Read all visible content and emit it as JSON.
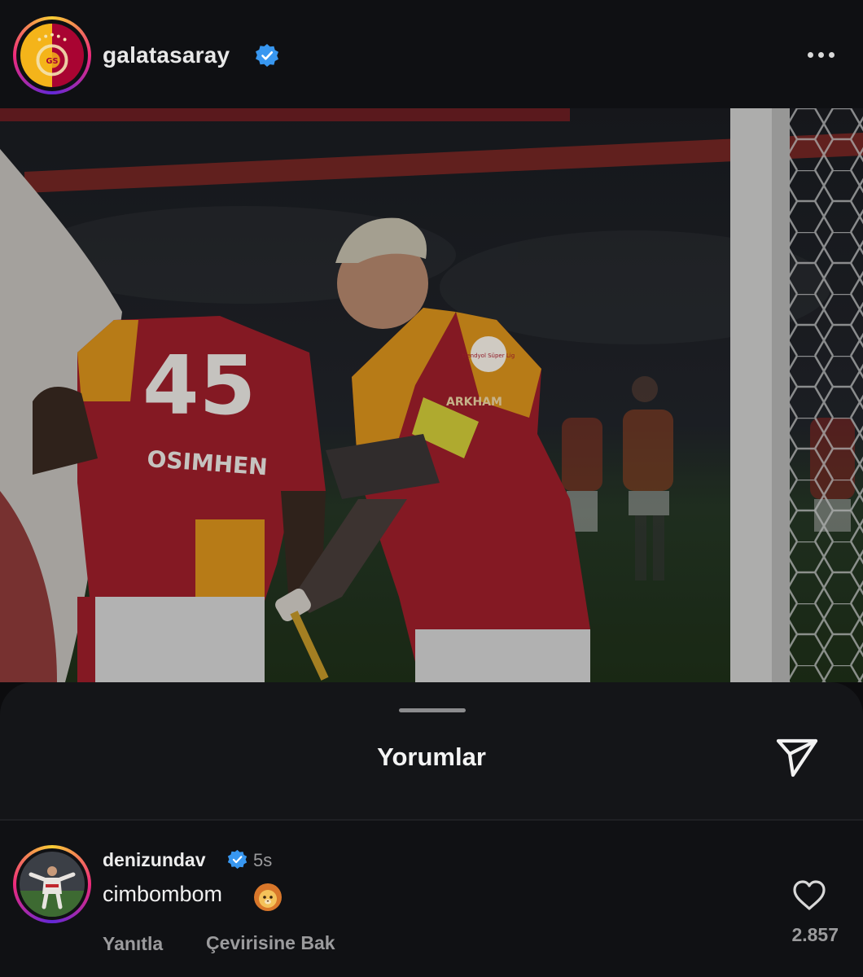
{
  "post": {
    "username": "galatasaray",
    "verified": true,
    "avatar_icon": "galatasaray-crest-icon",
    "more_icon": "more-horizontal-icon"
  },
  "photo": {
    "jersey_number": "45",
    "jersey_name": "OSIMHEN",
    "captain_armband": "captain-armband",
    "sponsor_badge": "trendyol Süper Lig",
    "sponsor_text": "ARKHAM",
    "colors": {
      "red": "#a2202a",
      "yellow": "#e59a1f",
      "pitch": "#24361f"
    }
  },
  "comments_sheet": {
    "title": "Yorumlar",
    "share_icon": "send-icon",
    "comment": {
      "username": "denizundav",
      "verified": true,
      "time": "5s",
      "text": "cimbombom",
      "emoji": "lion-face-icon",
      "reply_label": "Yanıtla",
      "translate_label": "Çevirisine Bak",
      "like_count": "2.857",
      "like_icon": "heart-outline-icon"
    }
  },
  "theme": {
    "background": "#0c0c0e",
    "sheet": "#141518",
    "verified_blue": "#3897f0",
    "muted_text": "#9b9b9d"
  }
}
